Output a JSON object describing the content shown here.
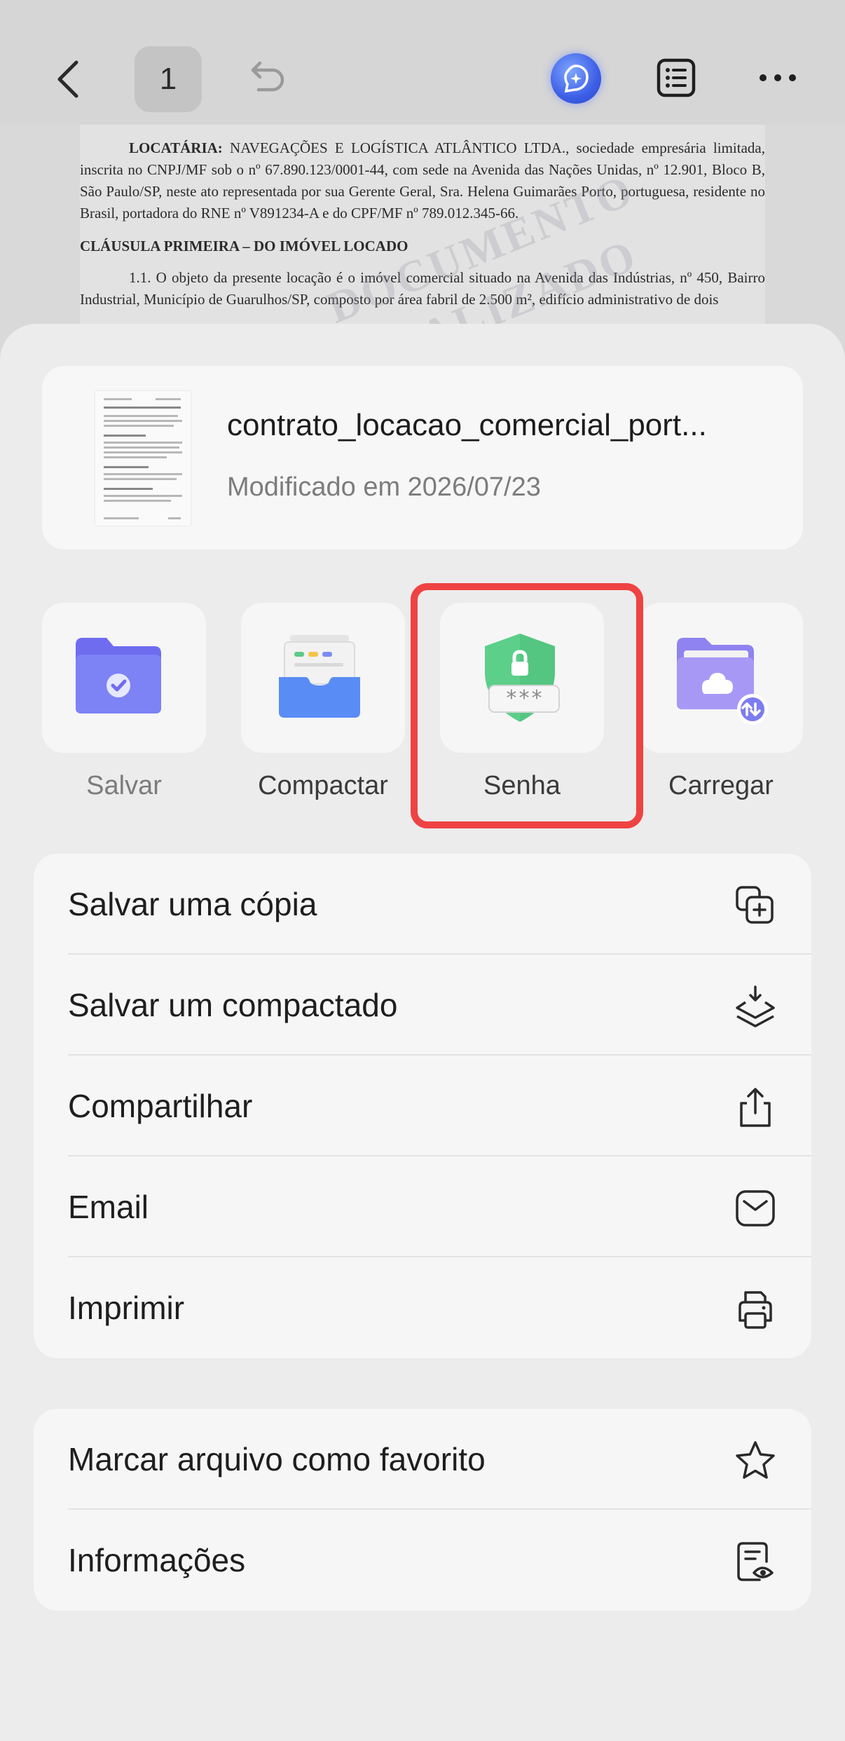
{
  "topbar": {
    "page_number": "1"
  },
  "document": {
    "p1_lead": "LOCATÁRIA:",
    "p1_body": " NAVEGAÇÕES E LOGÍSTICA ATLÂNTICO LTDA., sociedade empresária limitada, inscrita no CNPJ/MF sob o nº 67.890.123/0001-44, com sede na Avenida das Nações Unidas, nº 12.901, Bloco B, São Paulo/SP, neste ato representada por sua Gerente Geral, Sra. Helena Guimarães Porto, portuguesa, residente no Brasil, portadora do RNE nº V891234-A e do CPF/MF nº 789.012.345-66.",
    "heading": "CLÁUSULA PRIMEIRA – DO IMÓVEL LOCADO",
    "p2": "1.1. O objeto da presente locação é o imóvel comercial situado na Avenida das Indústrias, nº 450, Bairro Industrial, Município de Guarulhos/SP, composto por área fabril de 2.500 m², edifício administrativo de dois",
    "watermark_1": "DOCUMENTO",
    "watermark_2": "FINALIZADO"
  },
  "file": {
    "name": "contrato_locacao_comercial_port...",
    "modified": "Modificado em 2026/07/23"
  },
  "actions": [
    {
      "label": "Salvar",
      "icon": "folder-check-icon"
    },
    {
      "label": "Compactar",
      "icon": "archive-tray-icon"
    },
    {
      "label": "Senha",
      "icon": "password-shield-icon"
    },
    {
      "label": "Carregar",
      "icon": "cloud-folder-icon"
    }
  ],
  "menu_main": [
    {
      "label": "Salvar uma cópia",
      "icon": "copy-plus-icon"
    },
    {
      "label": "Salvar um compactado",
      "icon": "layers-download-icon"
    },
    {
      "label": "Compartilhar",
      "icon": "share-icon"
    },
    {
      "label": "Email",
      "icon": "mail-icon"
    },
    {
      "label": "Imprimir",
      "icon": "printer-icon"
    }
  ],
  "menu_secondary": [
    {
      "label": "Marcar arquivo como favorito",
      "icon": "star-icon"
    },
    {
      "label": "Informações",
      "icon": "document-info-icon"
    }
  ],
  "colors": {
    "highlight": "#ef4343",
    "accent_purple": "#7b7cf0",
    "shield_green": "#5cd38a",
    "secondary_text": "#7c7c7c"
  }
}
